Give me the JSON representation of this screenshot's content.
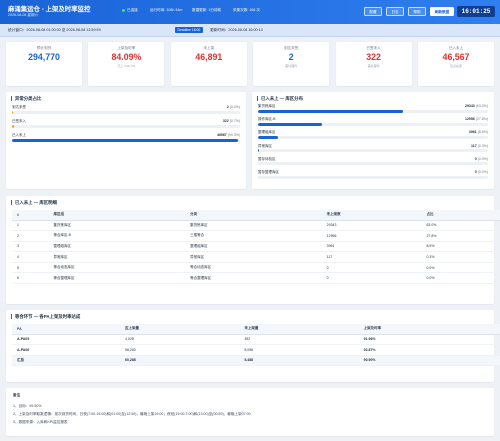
{
  "header": {
    "title": "麻涌集运仓 - 上架及时率监控",
    "date": "2026-08-08 星期六",
    "live": "已连接",
    "stats": [
      "运行时间: 108h 34m",
      "数据更新: 1分钟前",
      "采集次数: 166 次"
    ],
    "buttons": [
      "配置",
      "日志",
      "帮助",
      "刷新数据"
    ],
    "clock": "16:01:25"
  },
  "subbar": {
    "window": "统计窗口：2026-08-08 01:00:00 至 2026-08-08 12:59:59",
    "tag": "Deadline 16:00",
    "refresh": "更新时间：2026-08-08 16:00:14"
  },
  "kpis": [
    {
      "label": "预计到货",
      "value": "294,770",
      "note": "",
      "color": "blue"
    },
    {
      "label": "上架及时率",
      "value": "84.09%",
      "note": "已上 249,779",
      "color": "red"
    },
    {
      "label": "未上架",
      "value": "46,891",
      "note": "",
      "color": "red"
    },
    {
      "label": "到达未签",
      "value": "2",
      "note": "需处理件",
      "color": "blue"
    },
    {
      "label": "已签未入",
      "value": "322",
      "note": "需处理件",
      "color": "red"
    },
    {
      "label": "已入未上",
      "value": "46,567",
      "note": "应点在库",
      "color": "red"
    }
  ],
  "left_panel": {
    "title": "异常分类占比",
    "rows": [
      {
        "name": "到达未签",
        "count": "2",
        "pct": "(0.0%)",
        "ratio": 0.0005,
        "color": "#f59f00"
      },
      {
        "name": "已签未入",
        "count": "322",
        "pct": "(0.7%)",
        "ratio": 0.007,
        "color": "#f59f00"
      },
      {
        "name": "已入未上",
        "count": "46567",
        "pct": "(99.3%)",
        "ratio": 0.993,
        "color": "#1a63d6"
      }
    ]
  },
  "right_panel": {
    "title": "已入未上 — 库区分布",
    "rows": [
      {
        "name": "集货拣库区",
        "count": "29343",
        "pct": "(63.0%)",
        "ratio": 0.63
      },
      {
        "name": "操作库区-B",
        "count": "12956",
        "pct": "(27.8%)",
        "ratio": 0.278
      },
      {
        "name": "整理组库区",
        "count": "3961",
        "pct": "(8.5%)",
        "ratio": 0.085
      },
      {
        "name": "异常库区",
        "count": "117",
        "pct": "(0.3%)",
        "ratio": 0.003
      },
      {
        "name": "暂存待检区",
        "count": "0",
        "pct": "(0.0%)",
        "ratio": 0
      },
      {
        "name": "暂存整理库区",
        "count": "0",
        "pct": "(0.0%)",
        "ratio": 0
      }
    ]
  },
  "zone_table": {
    "title": "已入未上 — 库区明细",
    "headers": [
      "#",
      "库区组",
      "分类",
      "未上架数",
      "占比"
    ],
    "rows": [
      [
        "1",
        "集货拣库区",
        "集货拣库区",
        "29343",
        "63.0%"
      ],
      [
        "2",
        "等合库区-B",
        "三楼等合",
        "12956",
        "27.8%"
      ],
      [
        "3",
        "整理组库区",
        "整理组库区",
        "3961",
        "8.5%"
      ],
      [
        "4",
        "异常库区",
        "异常库区",
        "117",
        "0.3%"
      ],
      [
        "5",
        "等合动态库区",
        "等合动态库区",
        "0",
        "0.0%"
      ],
      [
        "6",
        "等合整理库区",
        "等合整理库区",
        "0",
        "0.0%"
      ]
    ]
  },
  "pa_table": {
    "title": "等合环节 — 各PA上架及时率达成",
    "headers": [
      "PA",
      "应上架量",
      "未上架量",
      "上架及时率"
    ],
    "rows": [
      [
        "A-PA05",
        "4,028",
        "392",
        "91.96%"
      ],
      [
        "A-PA06",
        "56,260",
        "5,096",
        "92.87%"
      ]
    ],
    "total": [
      "汇总",
      "60,288",
      "5,488",
      "90.90%"
    ]
  },
  "notes": {
    "title": "备注",
    "lines": [
      "1、目标：99.50%",
      "2、上架及时率取数逻辑：批次到货时间，日夜(7:00-19:00)和(01:00)至(12:59)，最晚上架19:00；夜班(19:00-7:00)和(13:00)至(00:59)，最晚上架07:00",
      "3、数据来源：入库和KPI监控报表"
    ]
  },
  "colors": {
    "brand": "#1a63d6",
    "alert": "#e03131"
  }
}
